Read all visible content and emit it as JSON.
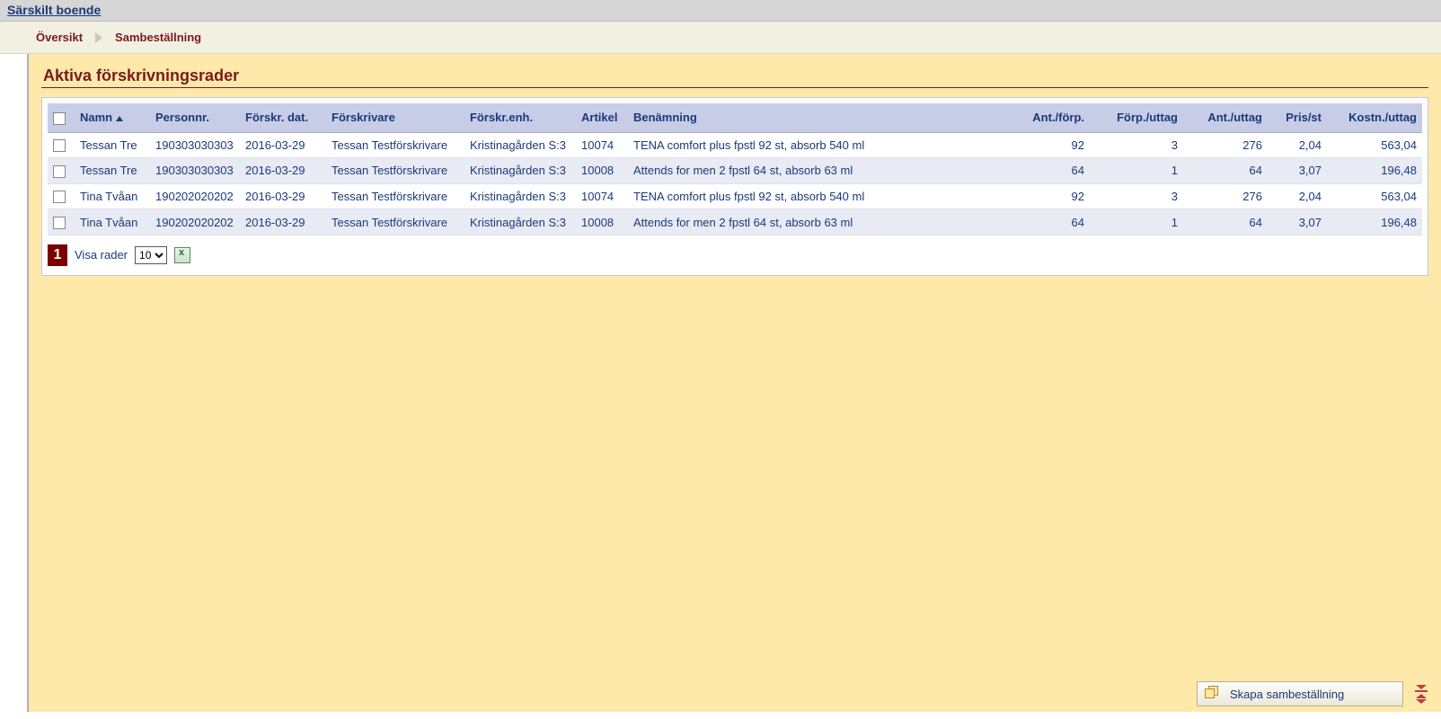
{
  "header": {
    "title": "Särskilt boende"
  },
  "breadcrumb": {
    "items": [
      "Översikt",
      "Sambeställning"
    ]
  },
  "page": {
    "heading": "Aktiva förskrivningsrader"
  },
  "table": {
    "columns": [
      "",
      "Namn",
      "Personnr.",
      "Förskr. dat.",
      "Förskrivare",
      "Förskr.enh.",
      "Artikel",
      "Benämning",
      "Ant./förp.",
      "Förp./uttag",
      "Ant./uttag",
      "Pris/st",
      "Kostn./uttag"
    ],
    "sort_column": "Namn",
    "rows": [
      {
        "name": "Tessan Tre",
        "pn": "190303030303",
        "date": "2016-03-29",
        "prescriber": "Tessan Testförskrivare",
        "unit": "Kristinagården S:3",
        "article": "10074",
        "desc": "TENA comfort plus fpstl 92 st, absorb 540 ml",
        "qty_per_pack": "92",
        "packs_per_uttag": "3",
        "qty_per_uttag": "276",
        "price": "2,04",
        "cost": "563,04"
      },
      {
        "name": "Tessan Tre",
        "pn": "190303030303",
        "date": "2016-03-29",
        "prescriber": "Tessan Testförskrivare",
        "unit": "Kristinagården S:3",
        "article": "10008",
        "desc": "Attends for men 2 fpstl 64 st, absorb 63 ml",
        "qty_per_pack": "64",
        "packs_per_uttag": "1",
        "qty_per_uttag": "64",
        "price": "3,07",
        "cost": "196,48"
      },
      {
        "name": "Tina Tvåan",
        "pn": "190202020202",
        "date": "2016-03-29",
        "prescriber": "Tessan Testförskrivare",
        "unit": "Kristinagården S:3",
        "article": "10074",
        "desc": "TENA comfort plus fpstl 92 st, absorb 540 ml",
        "qty_per_pack": "92",
        "packs_per_uttag": "3",
        "qty_per_uttag": "276",
        "price": "2,04",
        "cost": "563,04"
      },
      {
        "name": "Tina Tvåan",
        "pn": "190202020202",
        "date": "2016-03-29",
        "prescriber": "Tessan Testförskrivare",
        "unit": "Kristinagården S:3",
        "article": "10008",
        "desc": "Attends for men 2 fpstl 64 st, absorb 63 ml",
        "qty_per_pack": "64",
        "packs_per_uttag": "1",
        "qty_per_uttag": "64",
        "price": "3,07",
        "cost": "196,48"
      }
    ]
  },
  "pager": {
    "current_page": "1",
    "rows_label": "Visa rader",
    "rows_value": "10"
  },
  "footer": {
    "action_label": "Skapa sambeställning"
  }
}
